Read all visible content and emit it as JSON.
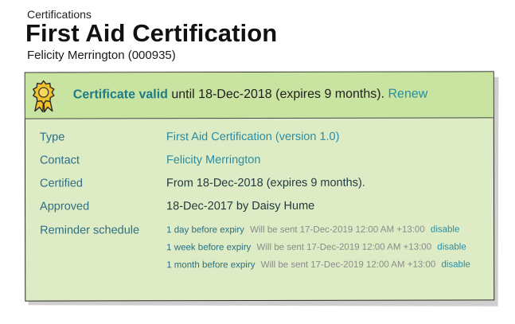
{
  "breadcrumb": "Certifications",
  "title": "First Aid Certification",
  "subtitle": "Felicity Merrington (000935)",
  "banner": {
    "status": "Certificate valid",
    "detail": " until 18-Dec-2018 (expires 9 months). ",
    "renew": "Renew"
  },
  "details": {
    "type_label": "Type",
    "type_value": "First Aid Certification  (version 1.0)",
    "contact_label": "Contact",
    "contact_value": "Felicity Merrington",
    "certified_label": "Certified",
    "certified_value": "From 18-Dec-2018 (expires 9 months).",
    "approved_label": "Approved",
    "approved_value": "18-Dec-2017 by Daisy Hume",
    "reminder_label": "Reminder schedule"
  },
  "reminders": [
    {
      "when": "1 day before expiry",
      "note": "Will be sent 17-Dec-2019 12:00 AM +13:00",
      "action": "disable"
    },
    {
      "when": "1 week before expiry",
      "note": "Will be sent 17-Dec-2019 12:00 AM +13:00",
      "action": "disable"
    },
    {
      "when": "1 month before expiry",
      "note": "Will be sent 17-Dec-2019 12:00 AM +13:00",
      "action": "disable"
    }
  ],
  "colors": {
    "banner_bg": "#c9e3a0",
    "card_bg": "#ddecc4",
    "accent": "#2a8ba3",
    "badge": "#f2c12e"
  },
  "icons": {
    "badge": "award-ribbon-icon"
  }
}
